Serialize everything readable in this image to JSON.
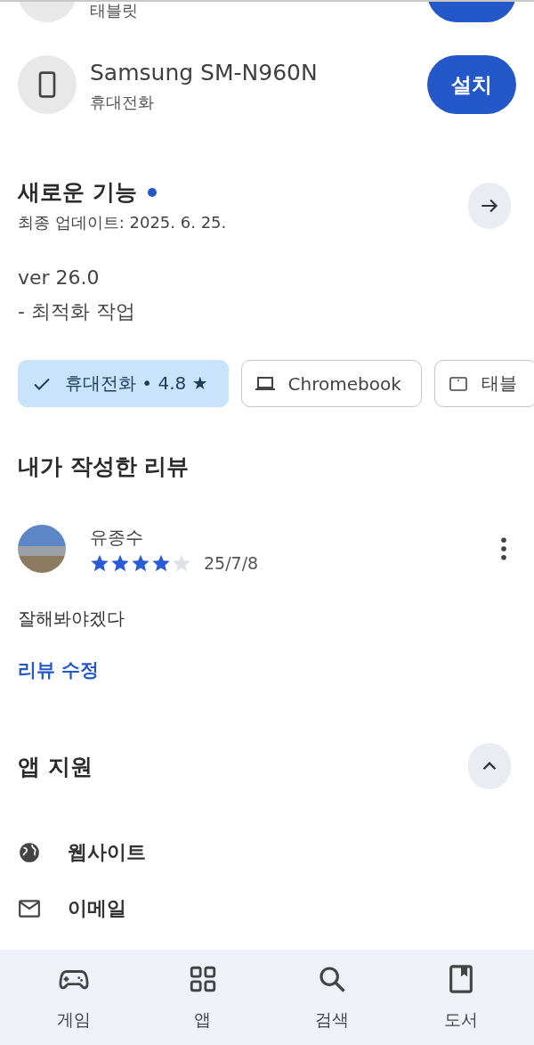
{
  "devices": [
    {
      "subtitle": "태블릿"
    },
    {
      "kind": "phone",
      "title": "Samsung SM-N960N",
      "subtitle": "휴대전화",
      "button": "설치"
    }
  ],
  "whats_new": {
    "title": "새로운 기능",
    "unread": true,
    "updated": "최종 업데이트: 2025. 6. 25.",
    "lines": [
      "ver 26.0",
      "- 최적화 작업"
    ]
  },
  "device_chips": [
    {
      "label": "휴대전화 • 4.8 ★",
      "selected": true
    },
    {
      "kind": "laptop",
      "label": "Chromebook",
      "selected": false
    },
    {
      "kind": "tablet",
      "label": "태블",
      "selected": false
    }
  ],
  "my_review": {
    "title": "내가 작성한 리뷰",
    "author": "유종수",
    "stars": 4,
    "date": "25/7/8",
    "text": "잘해봐야겠다",
    "edit_link": "리뷰 수정"
  },
  "app_support": {
    "title": "앱 지원",
    "expanded": true,
    "items": [
      {
        "kind": "web",
        "label": "웹사이트"
      },
      {
        "kind": "mail",
        "label": "이메일"
      }
    ]
  },
  "bottom_nav": [
    {
      "kind": "games",
      "label": "게임",
      "selected": false
    },
    {
      "kind": "apps",
      "label": "앱",
      "selected": false
    },
    {
      "kind": "search",
      "label": "검색",
      "selected": false
    },
    {
      "kind": "books",
      "label": "도서",
      "selected": false
    }
  ]
}
